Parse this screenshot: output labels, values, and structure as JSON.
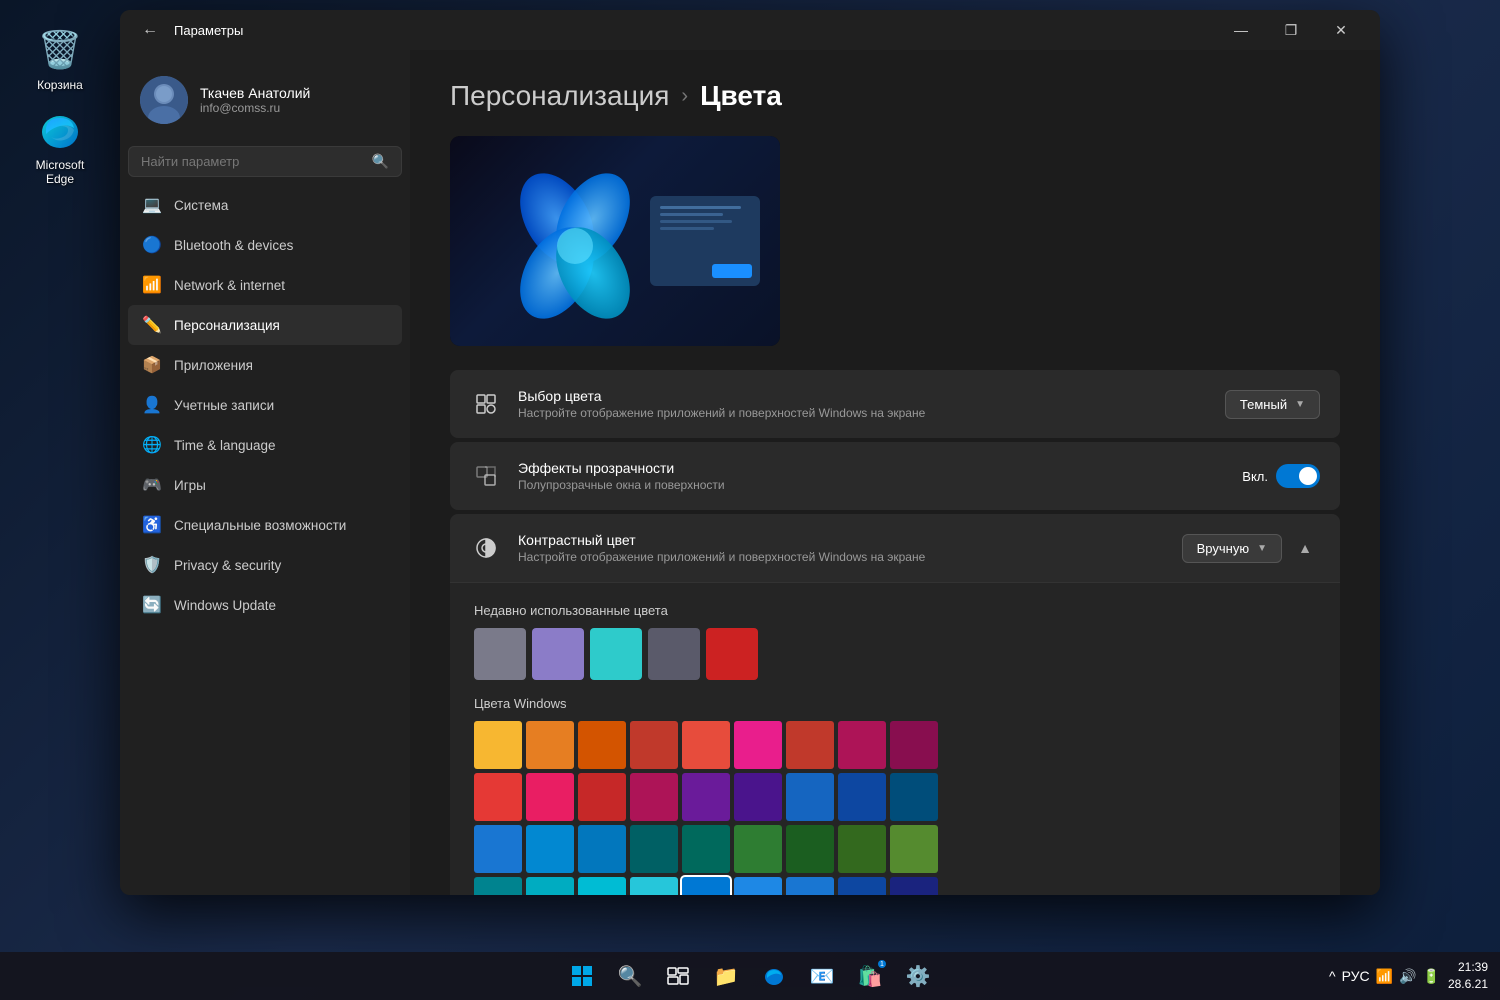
{
  "desktop": {
    "icons": [
      {
        "id": "recycle-bin",
        "label": "Корзина",
        "emoji": "🗑️"
      }
    ]
  },
  "taskbar": {
    "time": "21:39",
    "date": "28.6.21",
    "lang": "РУС",
    "icons": [
      "⊞",
      "🔍",
      "☰",
      "📁",
      "🌐",
      "📧",
      "🎮",
      "⚙️"
    ]
  },
  "window": {
    "title": "Параметры",
    "back_label": "←",
    "controls": [
      "—",
      "❐",
      "✕"
    ]
  },
  "user": {
    "name": "Ткачев Анатолий",
    "email": "info@comss.ru"
  },
  "search": {
    "placeholder": "Найти параметр"
  },
  "nav": [
    {
      "id": "system",
      "label": "Система",
      "icon": "💻",
      "active": false
    },
    {
      "id": "bluetooth",
      "label": "Bluetooth & devices",
      "icon": "🔵",
      "active": false
    },
    {
      "id": "network",
      "label": "Network & internet",
      "icon": "📶",
      "active": false
    },
    {
      "id": "personalization",
      "label": "Персонализация",
      "icon": "✏️",
      "active": true
    },
    {
      "id": "apps",
      "label": "Приложения",
      "icon": "📦",
      "active": false
    },
    {
      "id": "accounts",
      "label": "Учетные записи",
      "icon": "👤",
      "active": false
    },
    {
      "id": "time",
      "label": "Time & language",
      "icon": "🌐",
      "active": false
    },
    {
      "id": "gaming",
      "label": "Игры",
      "icon": "🎮",
      "active": false
    },
    {
      "id": "accessibility",
      "label": "Специальные возможности",
      "icon": "♿",
      "active": false
    },
    {
      "id": "privacy",
      "label": "Privacy & security",
      "icon": "🛡️",
      "active": false
    },
    {
      "id": "update",
      "label": "Windows Update",
      "icon": "🔄",
      "active": false
    }
  ],
  "breadcrumb": {
    "parent": "Персонализация",
    "separator": "›",
    "current": "Цвета"
  },
  "settings": {
    "color_choice": {
      "title": "Выбор цвета",
      "desc": "Настройте отображение приложений и поверхностей Windows на экране",
      "value": "Темный",
      "icon": "🎨"
    },
    "transparency": {
      "title": "Эффекты прозрачности",
      "desc": "Полупрозрачные окна и поверхности",
      "enabled": true,
      "enabled_label": "Вкл.",
      "icon": "✨"
    },
    "contrast": {
      "title": "Контрастный цвет",
      "desc": "Настройте отображение приложений и поверхностей Windows на экране",
      "value": "Вручную",
      "icon": "🔆",
      "expanded": true
    }
  },
  "recent_colors": {
    "label": "Недавно использованные цвета",
    "swatches": [
      "#7a7a8a",
      "#8b7cc8",
      "#2ecbcb",
      "#5a5a6a",
      "#cc2222"
    ]
  },
  "windows_colors": {
    "label": "Цвета Windows",
    "rows": [
      [
        "#f7b731",
        "#e67e22",
        "#d35400",
        "#c0392b",
        "#e74c3c",
        "#e91e8c",
        "#c0392b",
        "#ad1457",
        "#880e4f"
      ],
      [
        "#e53935",
        "#e91e63",
        "#c62828",
        "#ad1457",
        "#6a1b9a",
        "#4a148c",
        "#1565c0",
        "#0d47a1",
        "#004d7a"
      ],
      [
        "#1976d2",
        "#0288d1",
        "#0277bd",
        "#006064",
        "#00695c",
        "#2e7d32",
        "#1b5e20",
        "#33691e",
        "#558b2f"
      ],
      [
        "#00838f",
        "#00acc1",
        "#00bcd4",
        "#26c6da",
        "#0078d4",
        "#1e88e5",
        "#1976d2",
        "#0d47a1",
        "#1a237e"
      ]
    ],
    "selected_color": "#0078d4"
  }
}
